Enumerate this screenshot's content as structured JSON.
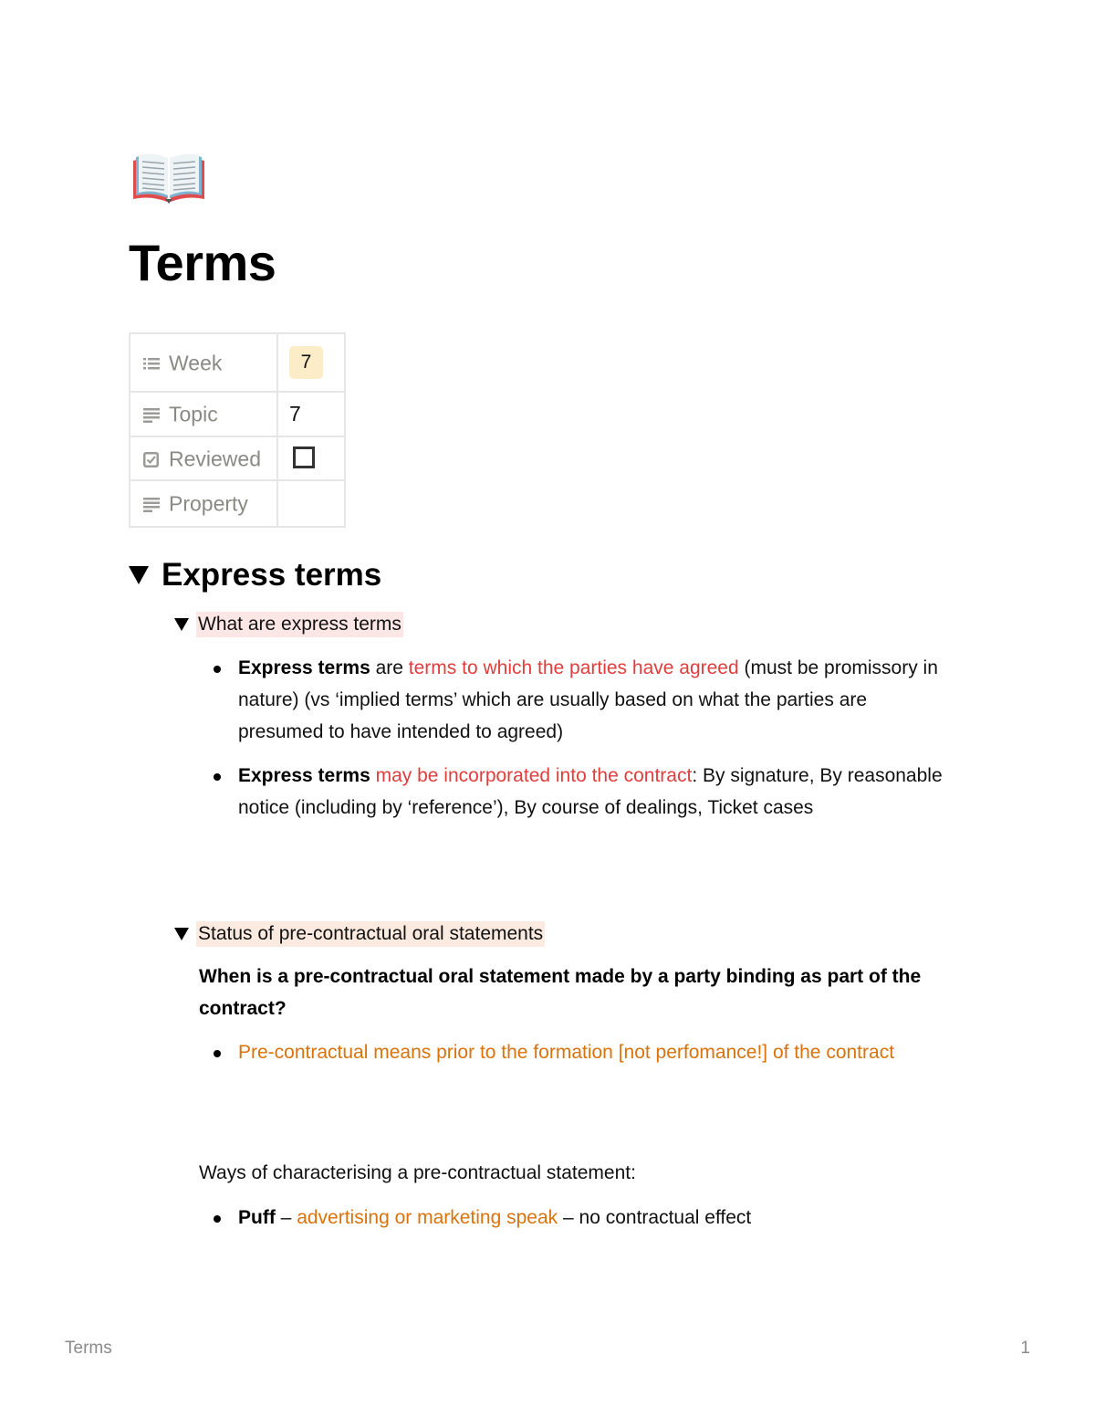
{
  "page": {
    "icon": "open-book-icon",
    "title": "Terms"
  },
  "properties": [
    {
      "icon": "list-icon",
      "label": "Week",
      "value": "7",
      "type": "select",
      "badge_color": "#fdecc8"
    },
    {
      "icon": "text-icon",
      "label": "Topic",
      "value": "7",
      "type": "text"
    },
    {
      "icon": "checkbox-icon",
      "label": "Reviewed",
      "value": "unchecked",
      "type": "checkbox"
    },
    {
      "icon": "text-icon",
      "label": "Property",
      "value": "",
      "type": "text"
    }
  ],
  "section": {
    "heading": "Express terms",
    "toggle1": {
      "label": "What are express terms",
      "highlight": "#fde6e6",
      "bullets": [
        {
          "bold": "Express terms",
          "pre": " are ",
          "colored": "terms to which the parties have agreed",
          "post": " (must be promissory in nature) (vs ‘implied terms’ which are usually based on what the parties are presumed to have intended to agreed)"
        },
        {
          "bold": "Express terms",
          "pre": " ",
          "colored": "may be incorporated into the contract",
          "post": ": By signature, By reasonable notice (including by ‘reference’), By course of dealings, Ticket cases"
        }
      ]
    },
    "toggle2": {
      "label": "Status of pre-contractual oral statements",
      "highlight": "#fbeadf",
      "question": "When is a pre-contractual oral statement made by a party binding as part of the contract?",
      "note": "Pre-contractual means prior to the formation [not perfomance!] of the contract",
      "ways_intro": "Ways of characterising a pre-contractual statement:",
      "ways": [
        {
          "bold": "Puff",
          "sep1": " – ",
          "colored": "advertising or marketing speak",
          "post": " – no contractual effect"
        }
      ]
    }
  },
  "colors": {
    "red_text": "#e03e3e",
    "orange_text": "#d9730d"
  },
  "footer": {
    "title": "Terms",
    "page_number": "1"
  }
}
